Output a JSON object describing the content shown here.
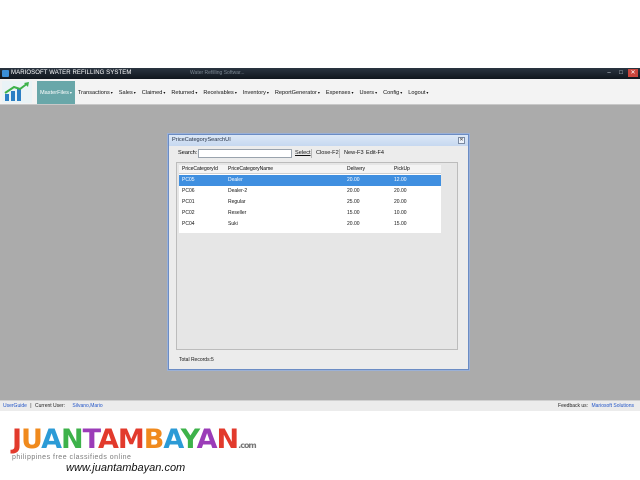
{
  "window": {
    "title": "MARIOSOFT WATER REFILLING SYSTEM",
    "faded_tab": "Water Refilling Softwar...",
    "min": "–",
    "max": "□",
    "close": "✕"
  },
  "menu": [
    {
      "label": "MasterFiles",
      "active": true
    },
    {
      "label": "Transactions"
    },
    {
      "label": "Sales"
    },
    {
      "label": "Claimed"
    },
    {
      "label": "Returned"
    },
    {
      "label": "Receivables"
    },
    {
      "label": "Inventory"
    },
    {
      "label": "ReportGenerator"
    },
    {
      "label": "Expenses"
    },
    {
      "label": "Users"
    },
    {
      "label": "Config"
    },
    {
      "label": "Logout"
    }
  ],
  "dialog": {
    "title": "PriceCategorySearchUI",
    "close": "✕",
    "search_label": "Search:",
    "search_value": "",
    "buttons": {
      "select": "Select",
      "close": "Close-F2",
      "new": "New-F3",
      "edit": "Edit-F4"
    },
    "columns": [
      "PriceCategoryId",
      "PriceCategoryName",
      "Delivery",
      "PickUp"
    ],
    "rows": [
      [
        "PC05",
        "Dealer",
        "20.00",
        "12.00"
      ],
      [
        "PC06",
        "Dealer-2",
        "20.00",
        "20.00"
      ],
      [
        "PC01",
        "Regular",
        "25.00",
        "20.00"
      ],
      [
        "PC02",
        "Reseller",
        "15.00",
        "10.00"
      ],
      [
        "PC04",
        "Suki",
        "20.00",
        "15.00"
      ]
    ],
    "selected_row": 0,
    "total_records": "Total Records:5"
  },
  "status": {
    "user_guide": "UserGuide",
    "separator": "|",
    "current_user_label": "Current User:",
    "current_user": "Silvano,Mario",
    "feedback_label": "Feedback us:",
    "feedback_link": "Mariosoft Solutions"
  },
  "watermark": {
    "brand": "JUANTAMBAYAN",
    "brand_suffix": ".com",
    "tagline": "philippines free classifieds online",
    "url": "www.juantambayan.com"
  },
  "colors": {
    "selected_row": "#3f8fe0",
    "active_menu": "#69a7a9",
    "desktop": "#ababab",
    "link": "#2255c8"
  }
}
